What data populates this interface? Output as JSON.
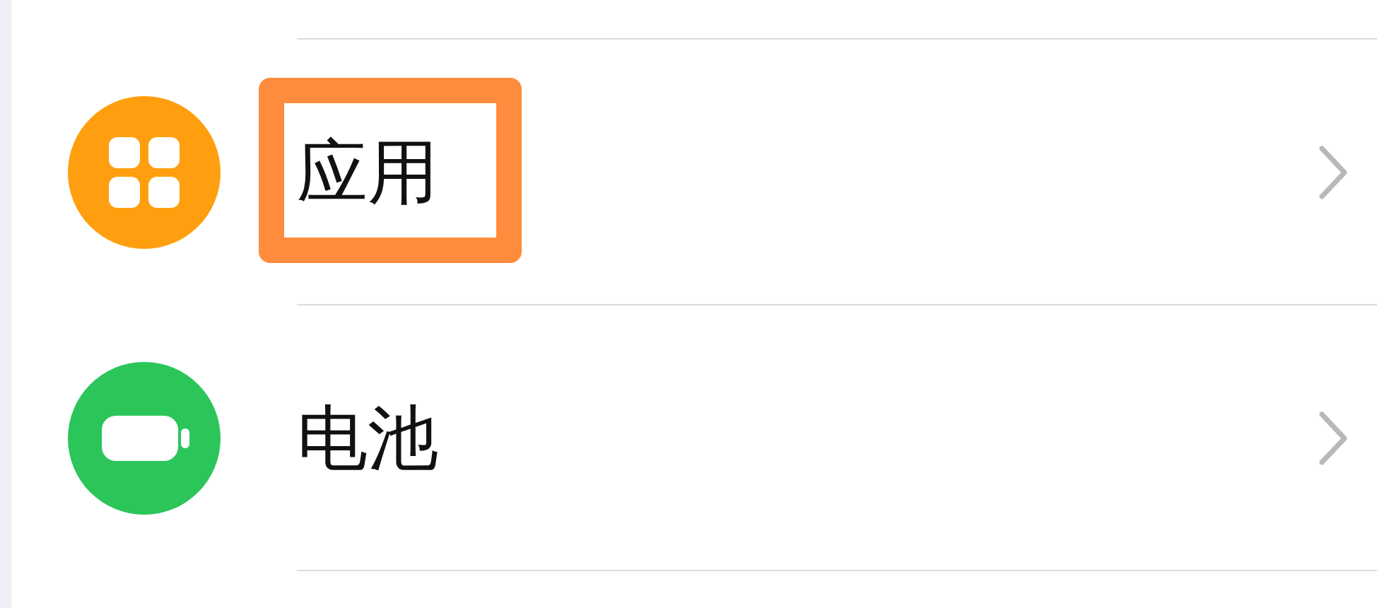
{
  "settings_items": [
    {
      "label": "应用",
      "kind": "apps",
      "color": "#ff9f0f",
      "highlighted": true
    },
    {
      "label": "电池",
      "kind": "battery",
      "color": "#2cc55a",
      "highlighted": false
    }
  ]
}
